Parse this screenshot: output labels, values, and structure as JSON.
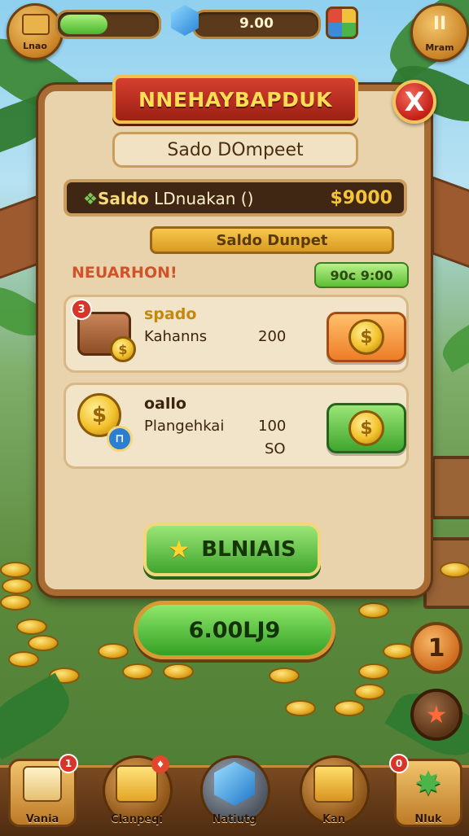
{
  "hud": {
    "left_button_label": "Lnao",
    "currency_value": "9.00",
    "right_button_label": "Mram",
    "right_button_icon": "II"
  },
  "panel": {
    "title": "NNEHAYBAPDUK",
    "close_icon": "X",
    "subtitle": "Sado DOmpeet",
    "balance": {
      "prefix": "Saldo",
      "label": " LDnuakan ()",
      "value": "$9000"
    },
    "section_tab": "Saldo Dunpet",
    "notice": "NEUARHON!",
    "timer": "90c 9:00",
    "offers": [
      {
        "badge": "3",
        "name": "spado",
        "subtitle": "Kahanns",
        "amount": "200",
        "button_color": "orange"
      },
      {
        "badge_icon": "ticket-icon",
        "name": "oallo",
        "subtitle": "Plangehkai",
        "amount": "100",
        "amount2": "SO",
        "button_color": "green"
      }
    ],
    "claim_button": "BLNIAIS"
  },
  "total_button": "6.00LJ9",
  "side": {
    "count_badge": "1"
  },
  "nav": [
    {
      "label": "Vania",
      "badge": "1"
    },
    {
      "label": "Clanpeqi",
      "badge": ""
    },
    {
      "label": "Natiutg",
      "badge": ""
    },
    {
      "label": "Kan",
      "badge": ""
    },
    {
      "label": "Nluk",
      "badge": "0"
    }
  ],
  "colors": {
    "accent_green": "#4bb52f",
    "title_red": "#c21f17",
    "gold": "#f3c22c",
    "wood": "#a86b34"
  }
}
